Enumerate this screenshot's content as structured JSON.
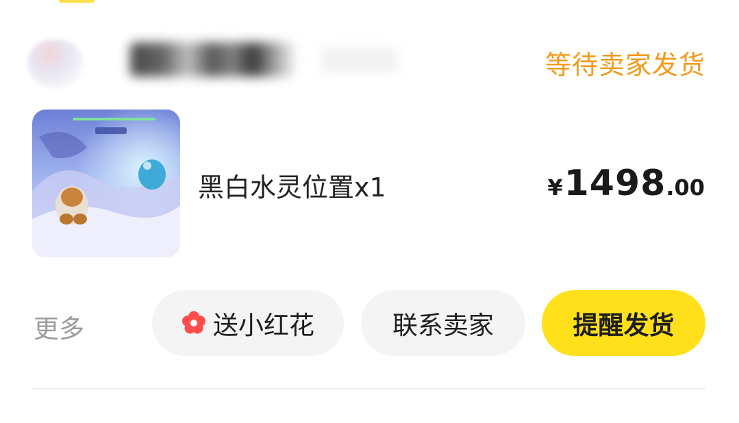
{
  "order": {
    "status": "等待卖家发货",
    "status_color": "#f39a1a"
  },
  "product": {
    "title": "黑白水灵位置x1",
    "price": {
      "currency": "¥",
      "integer": "1498",
      "decimal": ".00"
    }
  },
  "actions": {
    "more_label": "更多",
    "flower_label": "送小红花",
    "flower_icon": "flower-icon",
    "contact_label": "联系卖家",
    "remind_label": "提醒发货",
    "remind_color": "#ffe01b"
  }
}
